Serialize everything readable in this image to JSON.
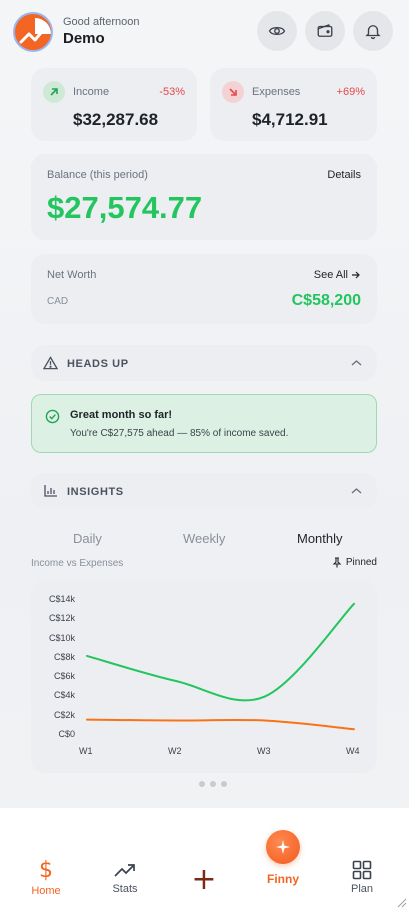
{
  "header": {
    "greeting": "Good afternoon",
    "user_name": "Demo",
    "icons": [
      "eye-icon",
      "wallet-icon",
      "bell-icon"
    ]
  },
  "income": {
    "label": "Income",
    "change": "-53%",
    "amount": "$32,287.68"
  },
  "expenses": {
    "label": "Expenses",
    "change": "+69%",
    "amount": "$4,712.91"
  },
  "balance": {
    "label": "Balance (this period)",
    "details_label": "Details",
    "amount": "$27,574.77"
  },
  "net_worth": {
    "label": "Net Worth",
    "see_all_label": "See All",
    "currency": "CAD",
    "amount": "C$58,200"
  },
  "heads_up": {
    "title": "HEADS UP",
    "alert_title": "Great month so far!",
    "alert_text": "You're C$27,575 ahead — 85% of income saved."
  },
  "insights": {
    "title": "INSIGHTS",
    "tabs": [
      "Daily",
      "Weekly",
      "Monthly"
    ],
    "active_tab": "Monthly",
    "chart_caption": "Income vs Expenses",
    "pinned_label": "Pinned"
  },
  "chart_data": {
    "type": "line",
    "title": "Income vs Expenses",
    "categories": [
      "W1",
      "W2",
      "W3",
      "W4"
    ],
    "y_ticks": [
      "C$0",
      "C$2k",
      "C$4k",
      "C$6k",
      "C$8k",
      "C$10k",
      "C$12k",
      "C$14k"
    ],
    "ylim": [
      0,
      14000
    ],
    "series": [
      {
        "values": [
          8200,
          5600,
          4000,
          13600
        ],
        "color": "#22c55e"
      },
      {
        "values": [
          1600,
          1500,
          1500,
          600
        ],
        "color": "#f97316"
      }
    ],
    "grid": false
  },
  "colors": {
    "accent": "#f26522",
    "positive": "#22c55e",
    "negative": "#e5484d"
  },
  "bottom_nav": {
    "home": "Home",
    "stats": "Stats",
    "add": "+",
    "finny": "Finny",
    "plan": "Plan"
  }
}
